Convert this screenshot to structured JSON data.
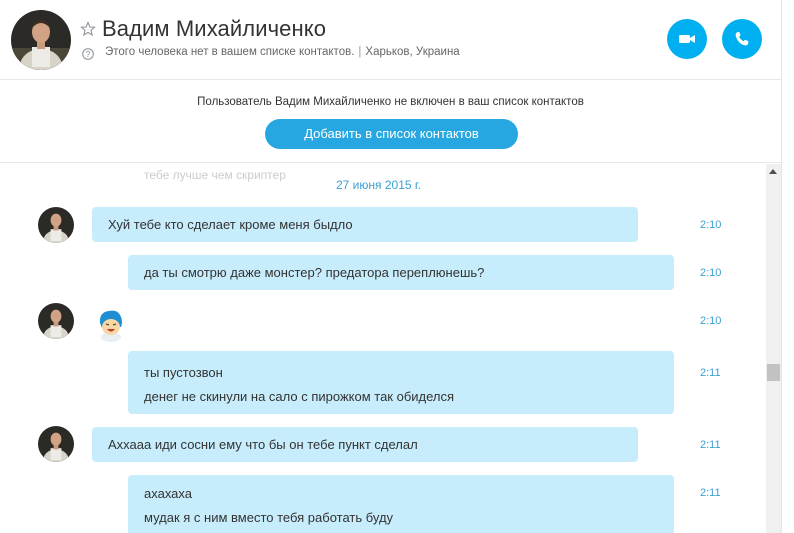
{
  "header": {
    "contact_name": "Вадим Михайличенко",
    "not_in_contacts": "Этого человека нет в вашем списке контактов.",
    "separator": "|",
    "location": "Харьков, Украина",
    "icons": {
      "favorite": "star-icon",
      "help": "question-icon",
      "video": "video-camera-icon",
      "call": "phone-icon"
    },
    "accent_color": "#00aff0"
  },
  "banner": {
    "text": "Пользователь Вадим Михайличенко не включен в ваш список контактов",
    "add_button": "Добавить в список контактов"
  },
  "chat": {
    "ghost_line": "тебе лучше чем скриптер",
    "date": "27 июня 2015 г.",
    "bubble_color": "#c7edfc",
    "messages": [
      {
        "side": "in",
        "lines": [
          "Хуй тебе кто сделает кроме меня быдло"
        ],
        "time": "2:10"
      },
      {
        "side": "out",
        "lines": [
          "да ты смотрю даже монстер? предатора переплюнешь?"
        ],
        "time": "2:10"
      },
      {
        "side": "in",
        "emoticon": "laughing-emoticon",
        "time": "2:10"
      },
      {
        "side": "out",
        "lines": [
          "ты пустозвон",
          "денег не скинули на сало с пирожком так обиделся"
        ],
        "time": "2:11"
      },
      {
        "side": "in",
        "lines": [
          "Аххааа иди сосни ему что бы он тебе пункт сделал"
        ],
        "time": "2:11"
      },
      {
        "side": "out",
        "lines": [
          "ахахаха",
          "мудак я с ним вместо тебя работать буду"
        ],
        "time": "2:11"
      }
    ]
  }
}
